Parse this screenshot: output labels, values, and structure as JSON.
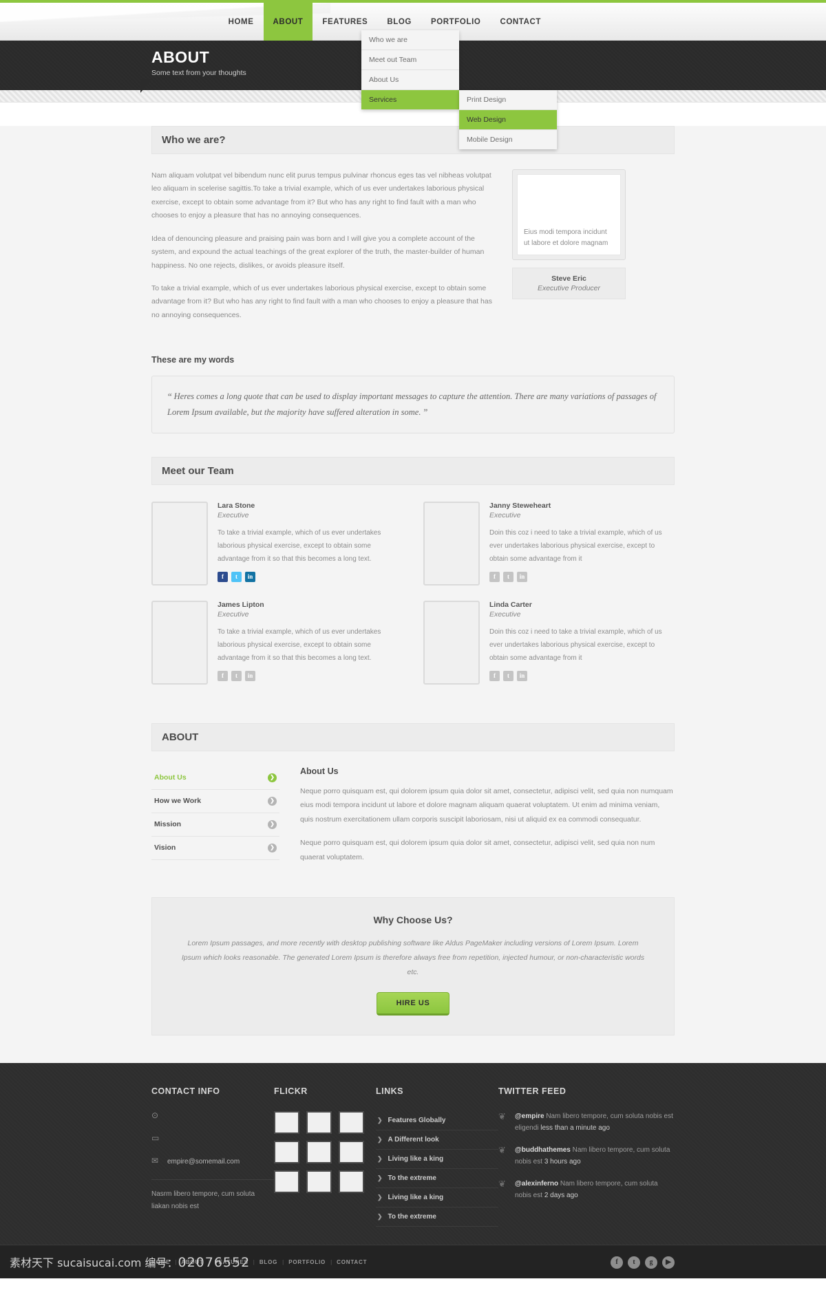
{
  "nav": {
    "items": [
      {
        "label": "HOME",
        "active": false
      },
      {
        "label": "ABOUT",
        "active": true
      },
      {
        "label": "FEATURES",
        "active": false
      },
      {
        "label": "BLOG",
        "active": false
      },
      {
        "label": "PORTFOLIO",
        "active": false
      },
      {
        "label": "CONTACT",
        "active": false
      }
    ],
    "dropdown": [
      {
        "label": "Who we are",
        "active": false
      },
      {
        "label": "Meet out Team",
        "active": false
      },
      {
        "label": "About Us",
        "active": false
      },
      {
        "label": "Services",
        "active": true
      }
    ],
    "subdropdown": [
      {
        "label": "Print Design",
        "active": false
      },
      {
        "label": "Web Design",
        "active": true
      },
      {
        "label": "Mobile Design",
        "active": false
      }
    ]
  },
  "banner": {
    "title": "ABOUT",
    "subtitle": "Some text from your thoughts"
  },
  "who": {
    "heading": "Who we are?",
    "paragraphs": [
      "Nam aliquam volutpat vel bibendum nunc elit purus tempus pulvinar rhoncus eges tas vel nibheas volutpat leo aliquam in scelerise sagittis.To take a trivial example, which of us ever undertakes laborious physical exercise, except to obtain some advantage from it? But who has any right to find fault with a man who chooses to enjoy a pleasure that has no annoying consequences.",
      "Idea of denouncing pleasure and praising pain was born and I will give you a complete account of the system, and expound the actual teachings of the great explorer of the truth, the master-builder of human happiness. No one rejects, dislikes, or avoids pleasure itself.",
      "To take a trivial example, which of us ever undertakes laborious physical exercise, except to obtain some advantage from it? But who has any right to find fault with a man who chooses to enjoy a pleasure that has no annoying consequences."
    ],
    "photo_caption": "Eius modi tempora incidunt ut labore et dolore magnam",
    "person_name": "Steve Eric",
    "person_role": "Executive Producer"
  },
  "words": {
    "title": "These are my words",
    "open_quote": "“",
    "close_quote": "”",
    "quote": "Heres comes a long quote that can be used to display important messages to capture the attention. There are many variations of passages of Lorem Ipsum available, but the majority have suffered alteration in some."
  },
  "team": {
    "heading": "Meet our Team",
    "members": [
      {
        "name": "Lara Stone",
        "role": "Executive",
        "desc": "To take a trivial example, which of us ever undertakes laborious physical exercise, except to obtain some advantage from it so that this becomes a long text.",
        "colored": true
      },
      {
        "name": "Janny Steweheart",
        "role": "Executive",
        "desc": "Doin this coz i need to take a trivial example, which of us ever undertakes laborious physical exercise, except to obtain some advantage from it",
        "colored": false
      },
      {
        "name": "James Lipton",
        "role": "Executive",
        "desc": "To take a trivial example, which of us ever undertakes laborious physical exercise, except to obtain some advantage from it so that this becomes a long text.",
        "colored": false
      },
      {
        "name": "Linda Carter",
        "role": "Executive",
        "desc": "Doin this coz i need to take a trivial example, which of us ever undertakes laborious physical exercise, except to obtain some advantage from it",
        "colored": false
      }
    ],
    "social_labels": [
      "f",
      "t",
      "in"
    ]
  },
  "about_tabs": {
    "heading": "ABOUT",
    "tabs": [
      {
        "label": "About Us",
        "active": true
      },
      {
        "label": "How we Work",
        "active": false
      },
      {
        "label": "Mission",
        "active": false
      },
      {
        "label": "Vision",
        "active": false
      }
    ],
    "content_title": "About Us",
    "content_paragraphs": [
      "Neque porro quisquam est, qui dolorem ipsum quia dolor sit amet, consectetur, adipisci velit, sed quia non numquam eius modi tempora incidunt ut labore et dolore magnam aliquam quaerat voluptatem. Ut enim ad minima veniam, quis nostrum exercitationem ullam corporis suscipit laboriosam, nisi ut aliquid ex ea commodi consequatur.",
      "Neque porro quisquam est, qui dolorem ipsum quia dolor sit amet, consectetur, adipisci velit, sed quia non num quaerat voluptatem."
    ]
  },
  "why": {
    "title": "Why Choose Us?",
    "text": "Lorem Ipsum passages, and more recently with desktop publishing software like Aldus PageMaker including versions of Lorem Ipsum. Lorem Ipsum which looks reasonable. The generated Lorem Ipsum is therefore always free from repetition, injected humour, or non-characteristic words etc.",
    "button": "HIRE US"
  },
  "footer": {
    "contact": {
      "heading": "CONTACT INFO",
      "rows": [
        {
          "icon": "location-pin-icon",
          "glyph": "⊙",
          "text": ""
        },
        {
          "icon": "mobile-phone-icon",
          "glyph": "▭",
          "text": ""
        },
        {
          "icon": "envelope-icon",
          "glyph": "✉",
          "text": "empire@somemail.com"
        }
      ],
      "address": "Nasrm libero tempore, cum soluta liakan nobis est"
    },
    "flickr": {
      "heading": "FLICKR",
      "thumb_count": 9
    },
    "links": {
      "heading": "LINKS",
      "items": [
        "Features Globally",
        "A Different look",
        "Living like a king",
        "To the extreme",
        "Living like a king",
        "To the extreme"
      ]
    },
    "twitter": {
      "heading": "TWITTER FEED",
      "tweets": [
        {
          "user": "@empire",
          "text": " Nam libero tempore, cum soluta nobis est eligendi ",
          "time": "less than a minute ago"
        },
        {
          "user": "@buddhathemes",
          "text": " Nam libero tempore, cum soluta nobis est ",
          "time": "3 hours ago"
        },
        {
          "user": "@alexinferno",
          "text": " Nam libero tempore, cum soluta nobis est ",
          "time": "2 days ago"
        }
      ]
    }
  },
  "bottombar": {
    "nav": [
      "HOME",
      "ABOUT",
      "FEATURES",
      "BLOG",
      "PORTFOLIO",
      "CONTACT"
    ],
    "separator": "|",
    "socials": [
      {
        "name": "facebook-icon",
        "glyph": "f"
      },
      {
        "name": "twitter-icon",
        "glyph": "t"
      },
      {
        "name": "google-plus-icon",
        "glyph": "g"
      },
      {
        "name": "youtube-icon",
        "glyph": "▶"
      }
    ],
    "watermark_text": "素材天下 sucaisucai.com 编号：",
    "watermark_number": "02076552"
  },
  "colors": {
    "accent_green": "#8dc63f",
    "dark": "#2b2b2b",
    "page_bg": "#f4f4f4"
  }
}
